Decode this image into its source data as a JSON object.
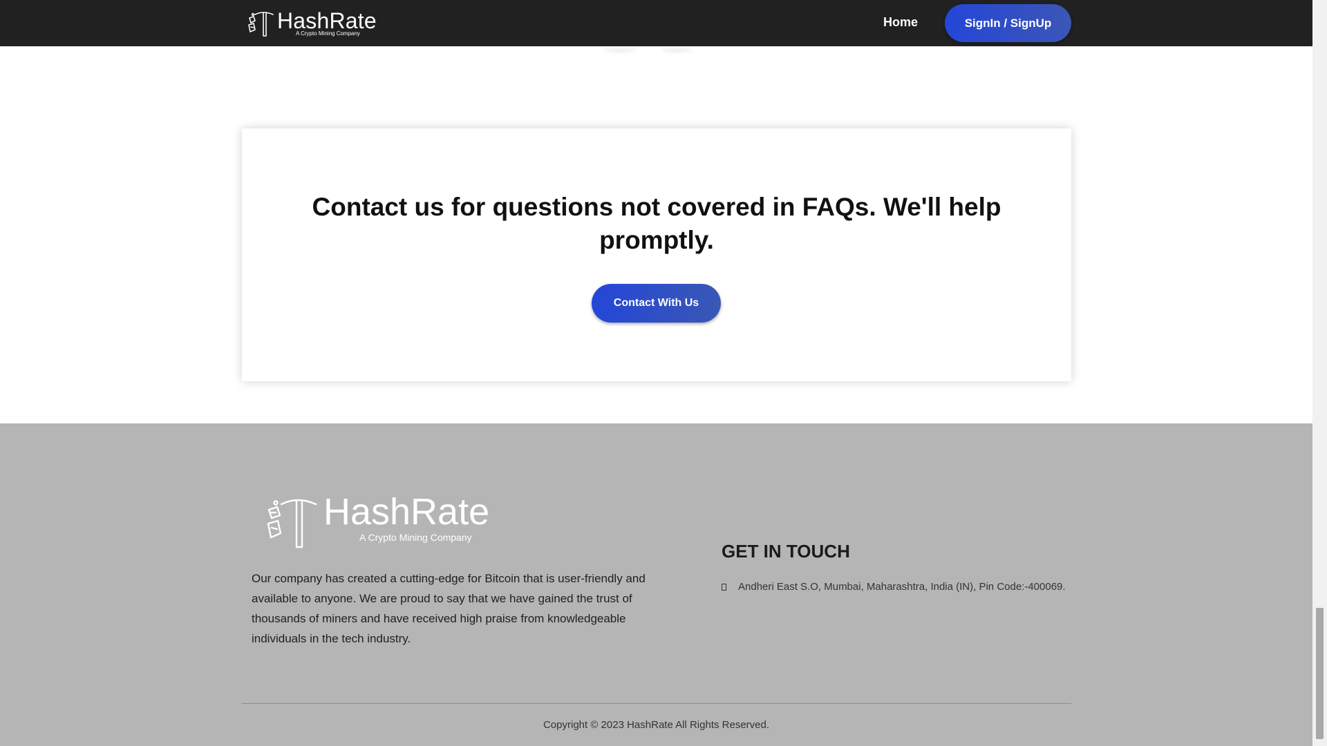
{
  "header": {
    "brand_name": "HashRate",
    "brand_tagline": "A Crypto Mining Company",
    "nav_home": "Home",
    "nav_signin": "SignIn / SignUp"
  },
  "contact": {
    "heading": "Contact us for questions not covered in FAQs. We'll help promptly.",
    "button_label": "Contact With Us"
  },
  "footer": {
    "brand_name": "HashRate",
    "brand_tagline": "A Crypto Mining Company",
    "about": "Our company has created a cutting-edge for Bitcoin that is user-friendly and available to anyone. We are proud to say that we have gained the trust of thousands of miners and have received high praise from knowledgeable individuals in the tech industry.",
    "get_in_touch_heading": "GET IN TOUCH",
    "address": "Andheri East S.O, Mumbai, Maharashtra, India (IN), Pin Code:-400069.",
    "copyright": "Copyright © 2023 HashRate All Rights Reserved."
  },
  "colors": {
    "header_bg": "#212121",
    "button_gradient_start": "#2446d8",
    "button_gradient_end": "#3c56b6",
    "footer_bg": "#b5b5b5"
  },
  "icons": {
    "logo": "pickaxe-crystal-logo-icon",
    "address": "location-pin-icon"
  }
}
